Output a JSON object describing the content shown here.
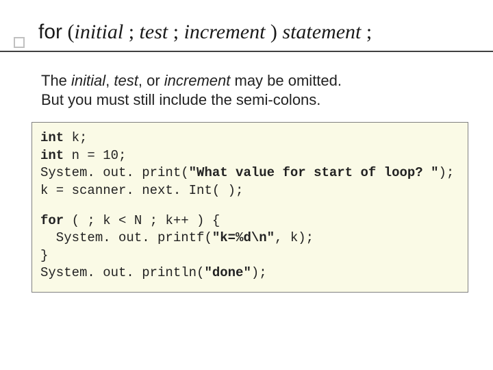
{
  "title": {
    "kw_for": "for",
    "lparen": " (",
    "initial": "initial",
    "sep1": " ; ",
    "test": "test",
    "sep2": " ; ",
    "increment": "increment",
    "rparen_sp": " ) ",
    "statement": "statement",
    "tail": " ;"
  },
  "body": {
    "line1a": "The ",
    "line1_initial": "initial",
    "line1b": ", ",
    "line1_test": "test",
    "line1c": ", or ",
    "line1_increment": "increment",
    "line1d": " may be omitted.",
    "line2": " But you must still include the semi-colons."
  },
  "code": {
    "l1a": "int",
    "l1b": " k;",
    "l2a": "int",
    "l2b": " n = 10;",
    "l3": "System. out. print(",
    "l3q": "\"What value for start of loop? \"",
    "l3end": ");",
    "l4": "k = scanner. next. Int( );",
    "l5a": "for",
    "l5b": " (   ;  k < N ;  k++ ) {",
    "l6": "  System. out. printf(",
    "l6q": "\"k=%d\\n\"",
    "l6end": ", k);",
    "l7": "}",
    "l8": "System. out. println(",
    "l8q": "\"done\"",
    "l8end": ");"
  }
}
